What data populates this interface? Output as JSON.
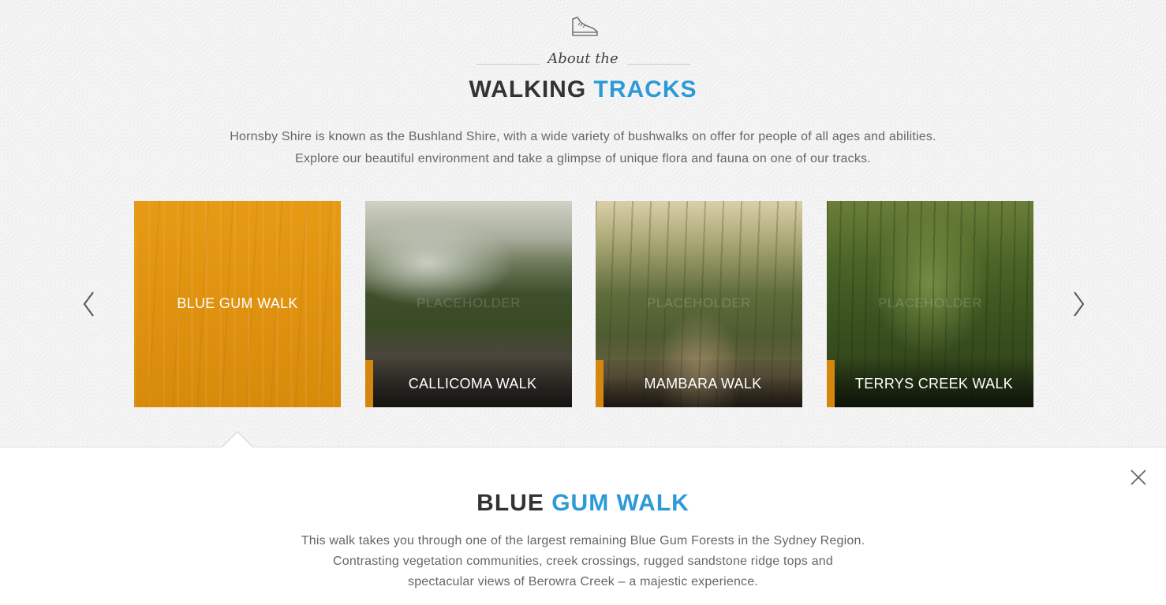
{
  "header": {
    "subtitle": "About the",
    "title_main": "WALKING",
    "title_accent": "TRACKS",
    "intro_line1": "Hornsby Shire is known as the Bushland Shire, with a wide variety of bushwalks on offer for people of all ages and abilities.",
    "intro_line2": "Explore our beautiful environment and take a glimpse of unique flora and fauna on one of our tracks."
  },
  "carousel": {
    "cards": [
      {
        "label": "BLUE GUM WALK",
        "active": true
      },
      {
        "label": "CALLICOMA WALK",
        "placeholder": "PLACEHOLDER"
      },
      {
        "label": "MAMBARA WALK",
        "placeholder": "PLACEHOLDER"
      },
      {
        "label": "TERRYS CREEK WALK",
        "placeholder": "PLACEHOLDER"
      }
    ]
  },
  "detail": {
    "title_main": "BLUE",
    "title_accent": "GUM WALK",
    "desc_line1": "This walk takes you through one of the largest remaining Blue Gum Forests in the Sydney Region.",
    "desc_line2": "Contrasting vegetation communities, creek crossings, rugged sandstone ridge tops and",
    "desc_line3": "spectacular views of Berowra Creek – a majestic experience."
  },
  "colors": {
    "accent_blue": "#2d9ad8",
    "accent_orange": "#e0930f"
  },
  "icons": {
    "header_icon": "shoe-icon",
    "prev": "chevron-left-icon",
    "next": "chevron-right-icon",
    "close": "close-icon"
  }
}
